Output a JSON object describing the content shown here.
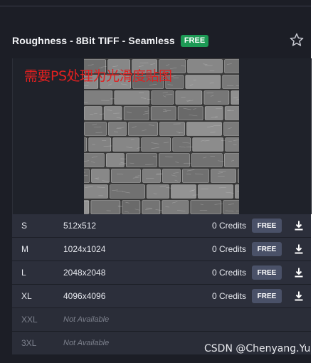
{
  "header": {
    "title": "Roughness - 8Bit TIFF - Seamless",
    "badge": "FREE"
  },
  "annotation": "需要PS处理为光滑度贴图",
  "rows": [
    {
      "size": "S",
      "res": "512x512",
      "credits": "0 Credits",
      "button": "FREE"
    },
    {
      "size": "M",
      "res": "1024x1024",
      "credits": "0 Credits",
      "button": "FREE"
    },
    {
      "size": "L",
      "res": "2048x2048",
      "credits": "0 Credits",
      "button": "FREE"
    },
    {
      "size": "XL",
      "res": "4096x4096",
      "credits": "0 Credits",
      "button": "FREE"
    },
    {
      "size": "XXL",
      "res": "Not Available"
    },
    {
      "size": "3XL",
      "res": "Not Available"
    }
  ],
  "watermark": "CSDN @Chenyang.Yu",
  "colors": {
    "free_badge": "#1d9a55",
    "free_button": "#4a5168",
    "annotation": "#e02020",
    "background": "#1c1e26"
  },
  "icons": {
    "favorite": "star-icon",
    "download": "download-icon"
  }
}
